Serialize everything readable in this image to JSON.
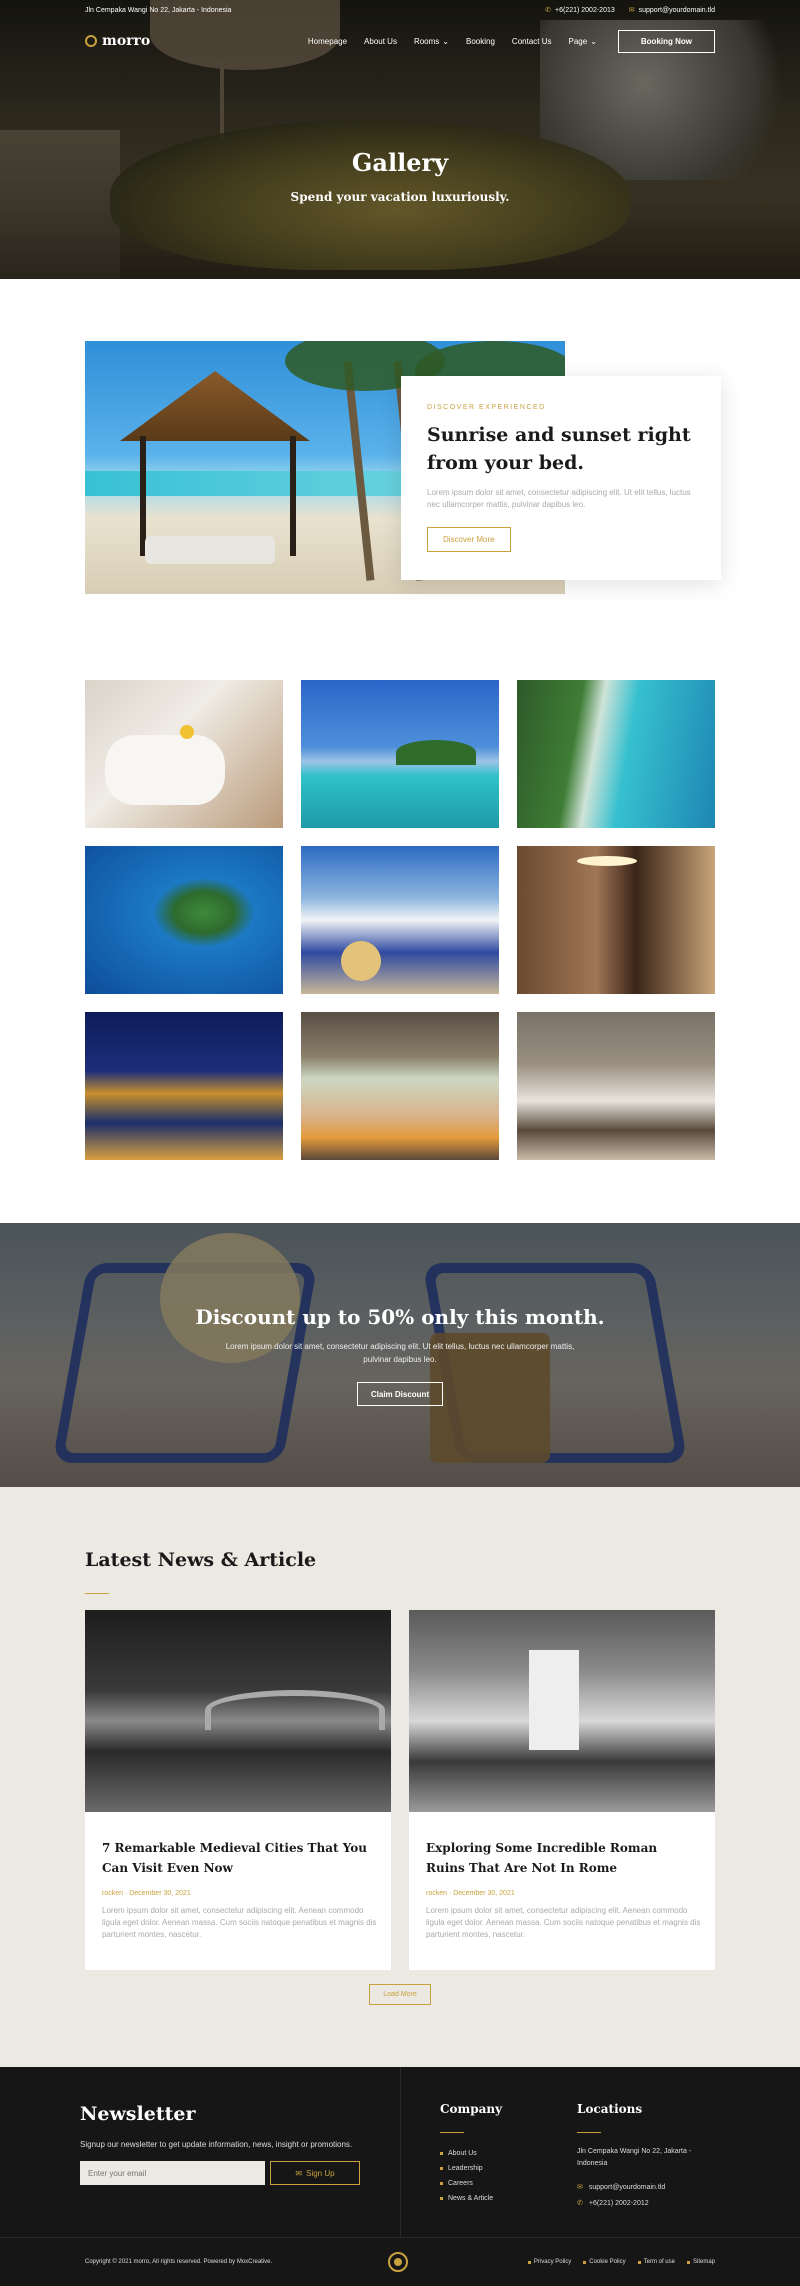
{
  "topbar": {
    "address": "Jln Cempaka Wangi No 22, Jakarta - Indonesia",
    "phone": "+6(221) 2002-2013",
    "email": "support@yourdomain.tld"
  },
  "nav": {
    "logo": "morro",
    "items": [
      "Homepage",
      "About Us",
      "Rooms",
      "Booking",
      "Contact Us",
      "Page"
    ],
    "booking_button": "Booking Now"
  },
  "hero": {
    "title": "Gallery",
    "subtitle": "Spend your vacation luxuriously."
  },
  "feature": {
    "kicker": "DISCOVER EXPERIENCED",
    "title": "Sunrise and sunset right from your bed.",
    "text": "Lorem ipsum dolor sit amet, consectetur adipiscing elit. Ut elit tellus, luctus nec ullamcorper mattis, pulvinar dapibus leo.",
    "button": "Discover More"
  },
  "gallery": {
    "items": [
      "towel-spa",
      "tropical-island",
      "aerial-beach",
      "aerial-islands",
      "beach-chairs",
      "hotel-suite",
      "night-castle-bridge",
      "bedroom-balcony",
      "bedroom-modern"
    ]
  },
  "promo": {
    "title": "Discount up to 50% only this month.",
    "text": "Lorem ipsum dolor sit amet, consectetur adipiscing elit. Ut elit tellus, luctus nec ullamcorper mattis, pulvinar dapibus leo.",
    "button": "Claim Discount"
  },
  "news": {
    "title": "Latest News & Article",
    "cards": [
      {
        "title": "7 Remarkable Medieval Cities That You Can Visit Even Now",
        "meta": "rocken · December 30, 2021",
        "text": "Lorem ipsum dolor sit amet, consectetur adipiscing elit. Aenean commodo ligula eget dolor. Aenean massa. Cum sociis natoque penatibus et magnis dis parturient montes, nascetur."
      },
      {
        "title": "Exploring Some Incredible Roman Ruins That Are Not In Rome",
        "meta": "rocken · December 30, 2021",
        "text": "Lorem ipsum dolor sit amet, consectetur adipiscing elit. Aenean commodo ligula eget dolor. Aenean massa. Cum sociis natoque penatibus et magnis dis parturient montes, nascetur."
      }
    ],
    "load_more": "Load More"
  },
  "footer": {
    "newsletter_title": "Newsletter",
    "newsletter_text": "Signup our newsletter to get update information, news, insight or promotions.",
    "email_placeholder": "Enter your email",
    "signup_button": "Sign Up",
    "company_title": "Company",
    "company_links": [
      "About Us",
      "Leadership",
      "Careers",
      "News & Article"
    ],
    "locations_title": "Locations",
    "location_address": "Jln Cempaka Wangi No 22, Jakarta - Indonesia",
    "location_email": "support@yourdomain.tld",
    "location_phone": "+6(221) 2002-2012",
    "copyright": "Copyright © 2021 morro, All rights reserved. Powered by MoxCreative.",
    "legal_links": [
      "Privacy Policy",
      "Cookie Policy",
      "Term of use",
      "Sitemap"
    ]
  }
}
